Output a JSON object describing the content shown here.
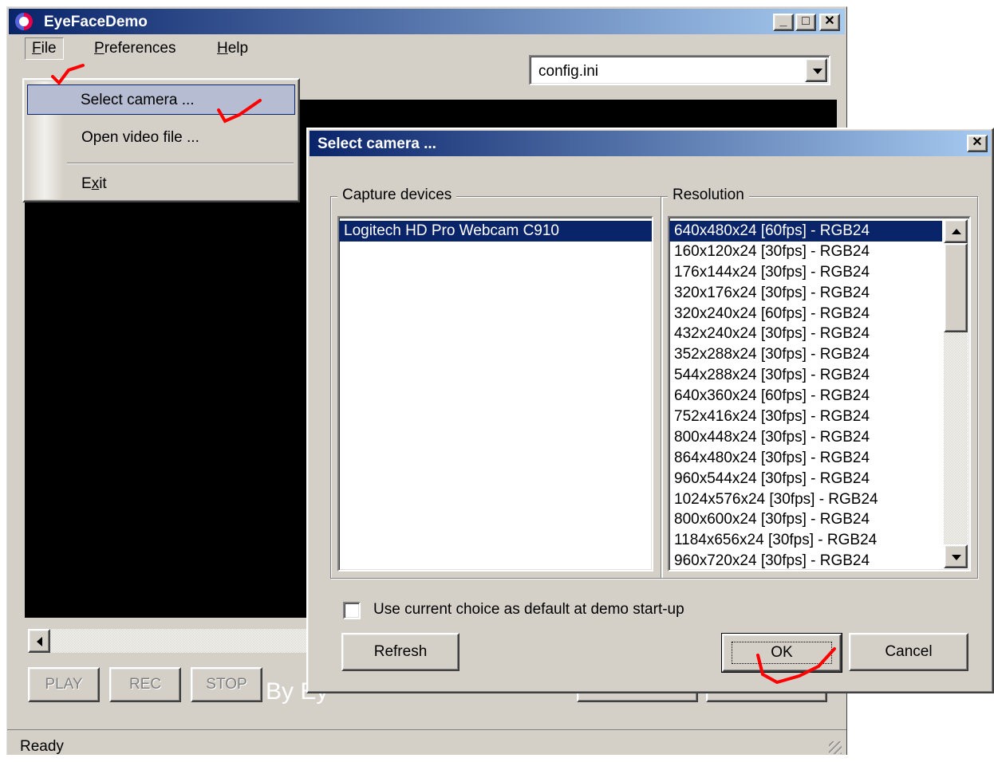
{
  "window": {
    "title": "EyeFaceDemo",
    "minimize": "_",
    "maximize": "□",
    "close": "✕"
  },
  "menubar": {
    "file": "File",
    "file_mnemonic": "F",
    "file_rest": "ile",
    "preferences_mnemonic": "P",
    "preferences_rest": "references",
    "help_mnemonic": "H",
    "help_rest": "elp"
  },
  "config_combo": {
    "value": "config.ini"
  },
  "video": {
    "caption": "By Ey"
  },
  "file_menu": {
    "items": [
      {
        "label": "Select camera ..."
      },
      {
        "label": "Open video file ..."
      }
    ],
    "exit_pre": "E",
    "exit_mnemonic": "x",
    "exit_rest": "it"
  },
  "controls": {
    "play": "PLAY",
    "rec": "REC",
    "stop": "STOP"
  },
  "status": {
    "text": "Ready"
  },
  "dialog": {
    "title": "Select camera ...",
    "close": "✕",
    "capture_devices": {
      "legend": "Capture devices",
      "items": [
        "Logitech HD Pro Webcam C910"
      ],
      "selected_index": 0
    },
    "resolution": {
      "legend": "Resolution",
      "items": [
        "640x480x24 [60fps] - RGB24",
        "160x120x24 [30fps] - RGB24",
        "176x144x24 [30fps] - RGB24",
        "320x176x24 [30fps] - RGB24",
        "320x240x24 [60fps] - RGB24",
        "432x240x24 [30fps] - RGB24",
        "352x288x24 [30fps] - RGB24",
        "544x288x24 [30fps] - RGB24",
        "640x360x24 [60fps] - RGB24",
        "752x416x24 [30fps] - RGB24",
        "800x448x24 [30fps] - RGB24",
        "864x480x24 [30fps] - RGB24",
        "960x544x24 [30fps] - RGB24",
        "1024x576x24 [30fps] - RGB24",
        "800x600x24 [30fps] - RGB24",
        "1184x656x24 [30fps] - RGB24",
        "960x720x24 [30fps] - RGB24"
      ],
      "selected_index": 0
    },
    "default_checkbox": {
      "label": "Use current choice as default at demo start-up",
      "checked": false
    },
    "refresh": "Refresh",
    "ok": "OK",
    "cancel": "Cancel"
  },
  "colors": {
    "face": "#d4d0c8",
    "title_start": "#0a246a",
    "title_end": "#a6caf0",
    "selection": "#0a246a",
    "annotation": "#ff0000"
  }
}
